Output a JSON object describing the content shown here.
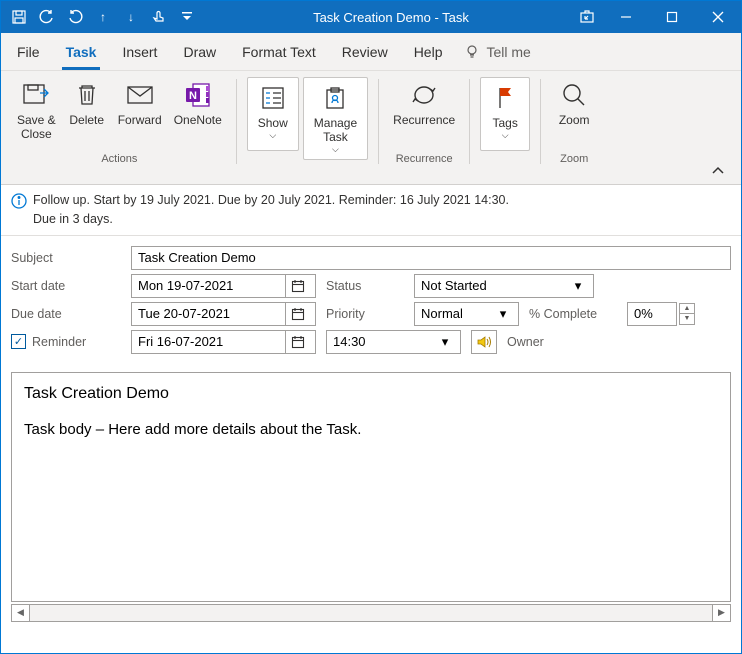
{
  "title": "Task Creation Demo  -  Task",
  "tabs": {
    "file": "File",
    "task": "Task",
    "insert": "Insert",
    "draw": "Draw",
    "format": "Format Text",
    "review": "Review",
    "help": "Help",
    "tellme": "Tell me"
  },
  "ribbon": {
    "saveClose": "Save &\nClose",
    "delete": "Delete",
    "forward": "Forward",
    "onenote": "OneNote",
    "show": "Show",
    "manageTask": "Manage\nTask",
    "recurrence": "Recurrence",
    "tags": "Tags",
    "zoom": "Zoom",
    "groups": {
      "actions": "Actions",
      "recurrence": "Recurrence",
      "zoom": "Zoom"
    }
  },
  "info": "Follow up.  Start by 19 July 2021.  Due by 20 July 2021.  Reminder: 16 July 2021 14:30.\nDue in 3 days.",
  "form": {
    "subjectLabel": "Subject",
    "subject": "Task Creation Demo",
    "startLabel": "Start date",
    "startDate": "Mon 19-07-2021",
    "dueLabel": "Due date",
    "dueDate": "Tue 20-07-2021",
    "statusLabel": "Status",
    "status": "Not Started",
    "priorityLabel": "Priority",
    "priority": "Normal",
    "pcLabel": "% Complete",
    "pcValue": "0%",
    "reminderLabel": "Reminder",
    "reminderDate": "Fri 16-07-2021",
    "reminderTime": "14:30",
    "ownerLabel": "Owner"
  },
  "body": {
    "title": "Task Creation Demo",
    "text": "Task body – Here add more details about the Task."
  }
}
